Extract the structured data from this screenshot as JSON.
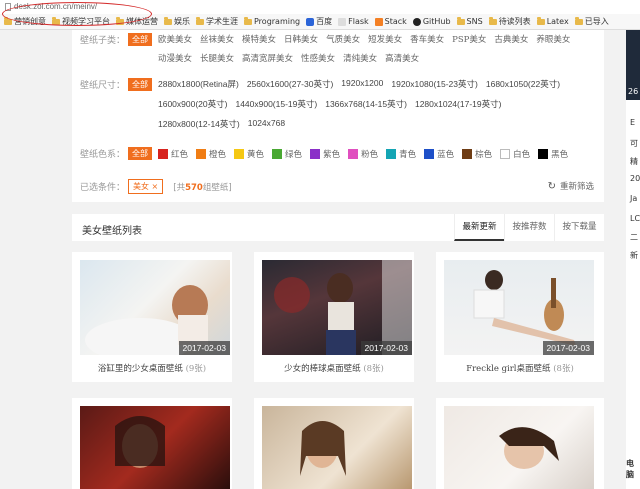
{
  "browser": {
    "url": "desk.zol.com.cn/meinv/",
    "bookmarks": [
      {
        "label": "营销创意",
        "icon": "folder-icon"
      },
      {
        "label": "视频学习平台",
        "icon": "folder-icon"
      },
      {
        "label": "媒体运营",
        "icon": "folder-icon"
      },
      {
        "label": "娱乐",
        "icon": "folder-icon"
      },
      {
        "label": "学术生涯",
        "icon": "folder-icon"
      },
      {
        "label": "Programing",
        "icon": "folder-icon"
      },
      {
        "label": "百度",
        "icon": "baidu-icon"
      },
      {
        "label": "Flask",
        "icon": "page-icon"
      },
      {
        "label": "Stack",
        "icon": "stack-icon"
      },
      {
        "label": "GitHub",
        "icon": "github-icon"
      },
      {
        "label": "SNS",
        "icon": "folder-icon"
      },
      {
        "label": "待读列表",
        "icon": "folder-icon"
      },
      {
        "label": "Latex",
        "icon": "folder-icon"
      },
      {
        "label": "已导入",
        "icon": "folder-icon"
      }
    ]
  },
  "filters": {
    "subtype_label": "壁纸子类：",
    "all_label": "全部",
    "subtypes": [
      "欧美美女",
      "丝袜美女",
      "模特美女",
      "日韩美女",
      "气质美女",
      "短发美女",
      "香车美女",
      "PSP美女",
      "古典美女",
      "养眼美女",
      "动漫美女",
      "长腿美女",
      "高清宽屏美女",
      "性感美女",
      "清纯美女",
      "高清美女"
    ],
    "size_label": "壁纸尺寸：",
    "sizes": [
      "2880x1800(Retina屏)",
      "2560x1600(27-30英寸)",
      "1920x1200",
      "1920x1080(15-23英寸)",
      "1680x1050(22英寸)",
      "1600x900(20英寸)",
      "1440x900(15-19英寸)",
      "1366x768(14-15英寸)",
      "1280x1024(17-19英寸)",
      "1280x800(12-14英寸)",
      "1024x768"
    ],
    "color_label": "壁纸色系：",
    "colors": [
      {
        "name": "红色",
        "hex": "#d7231e"
      },
      {
        "name": "橙色",
        "hex": "#f07d14"
      },
      {
        "name": "黄色",
        "hex": "#f5c814"
      },
      {
        "name": "绿色",
        "hex": "#49a832"
      },
      {
        "name": "紫色",
        "hex": "#8a2fc8"
      },
      {
        "name": "粉色",
        "hex": "#e04fbf"
      },
      {
        "name": "青色",
        "hex": "#14a5b4"
      },
      {
        "name": "蓝色",
        "hex": "#1e50c8"
      },
      {
        "name": "棕色",
        "hex": "#6e3c14"
      },
      {
        "name": "白色",
        "hex": "#ffffff"
      },
      {
        "name": "黑色",
        "hex": "#000000"
      }
    ],
    "selected_label": "已选条件：",
    "selected_tag": "美女",
    "total_prefix": "[共",
    "total_count": "570",
    "total_suffix": "组壁纸]",
    "reset_label": "重新筛选"
  },
  "list": {
    "title": "美女壁纸列表",
    "tabs": [
      "最新更新",
      "按推荐数",
      "按下载量"
    ],
    "cards": [
      {
        "caption": "浴缸里的少女桌面壁纸",
        "count": "(9张)",
        "date": "2017-02-03"
      },
      {
        "caption": "少女的棒球桌面壁纸",
        "count": "(8张)",
        "date": "2017-02-03"
      },
      {
        "caption": "Freckle girl桌面壁纸",
        "count": "(8张)",
        "date": "2017-02-03"
      },
      {
        "caption": "",
        "count": "",
        "date": ""
      },
      {
        "caption": "",
        "count": "",
        "date": ""
      },
      {
        "caption": "",
        "count": "",
        "date": ""
      }
    ]
  },
  "sidebar": {
    "items": [
      "26",
      "E",
      "可",
      "精",
      "20",
      "Ja",
      "LC",
      "二",
      "新"
    ],
    "bottom_title": "电脑"
  }
}
